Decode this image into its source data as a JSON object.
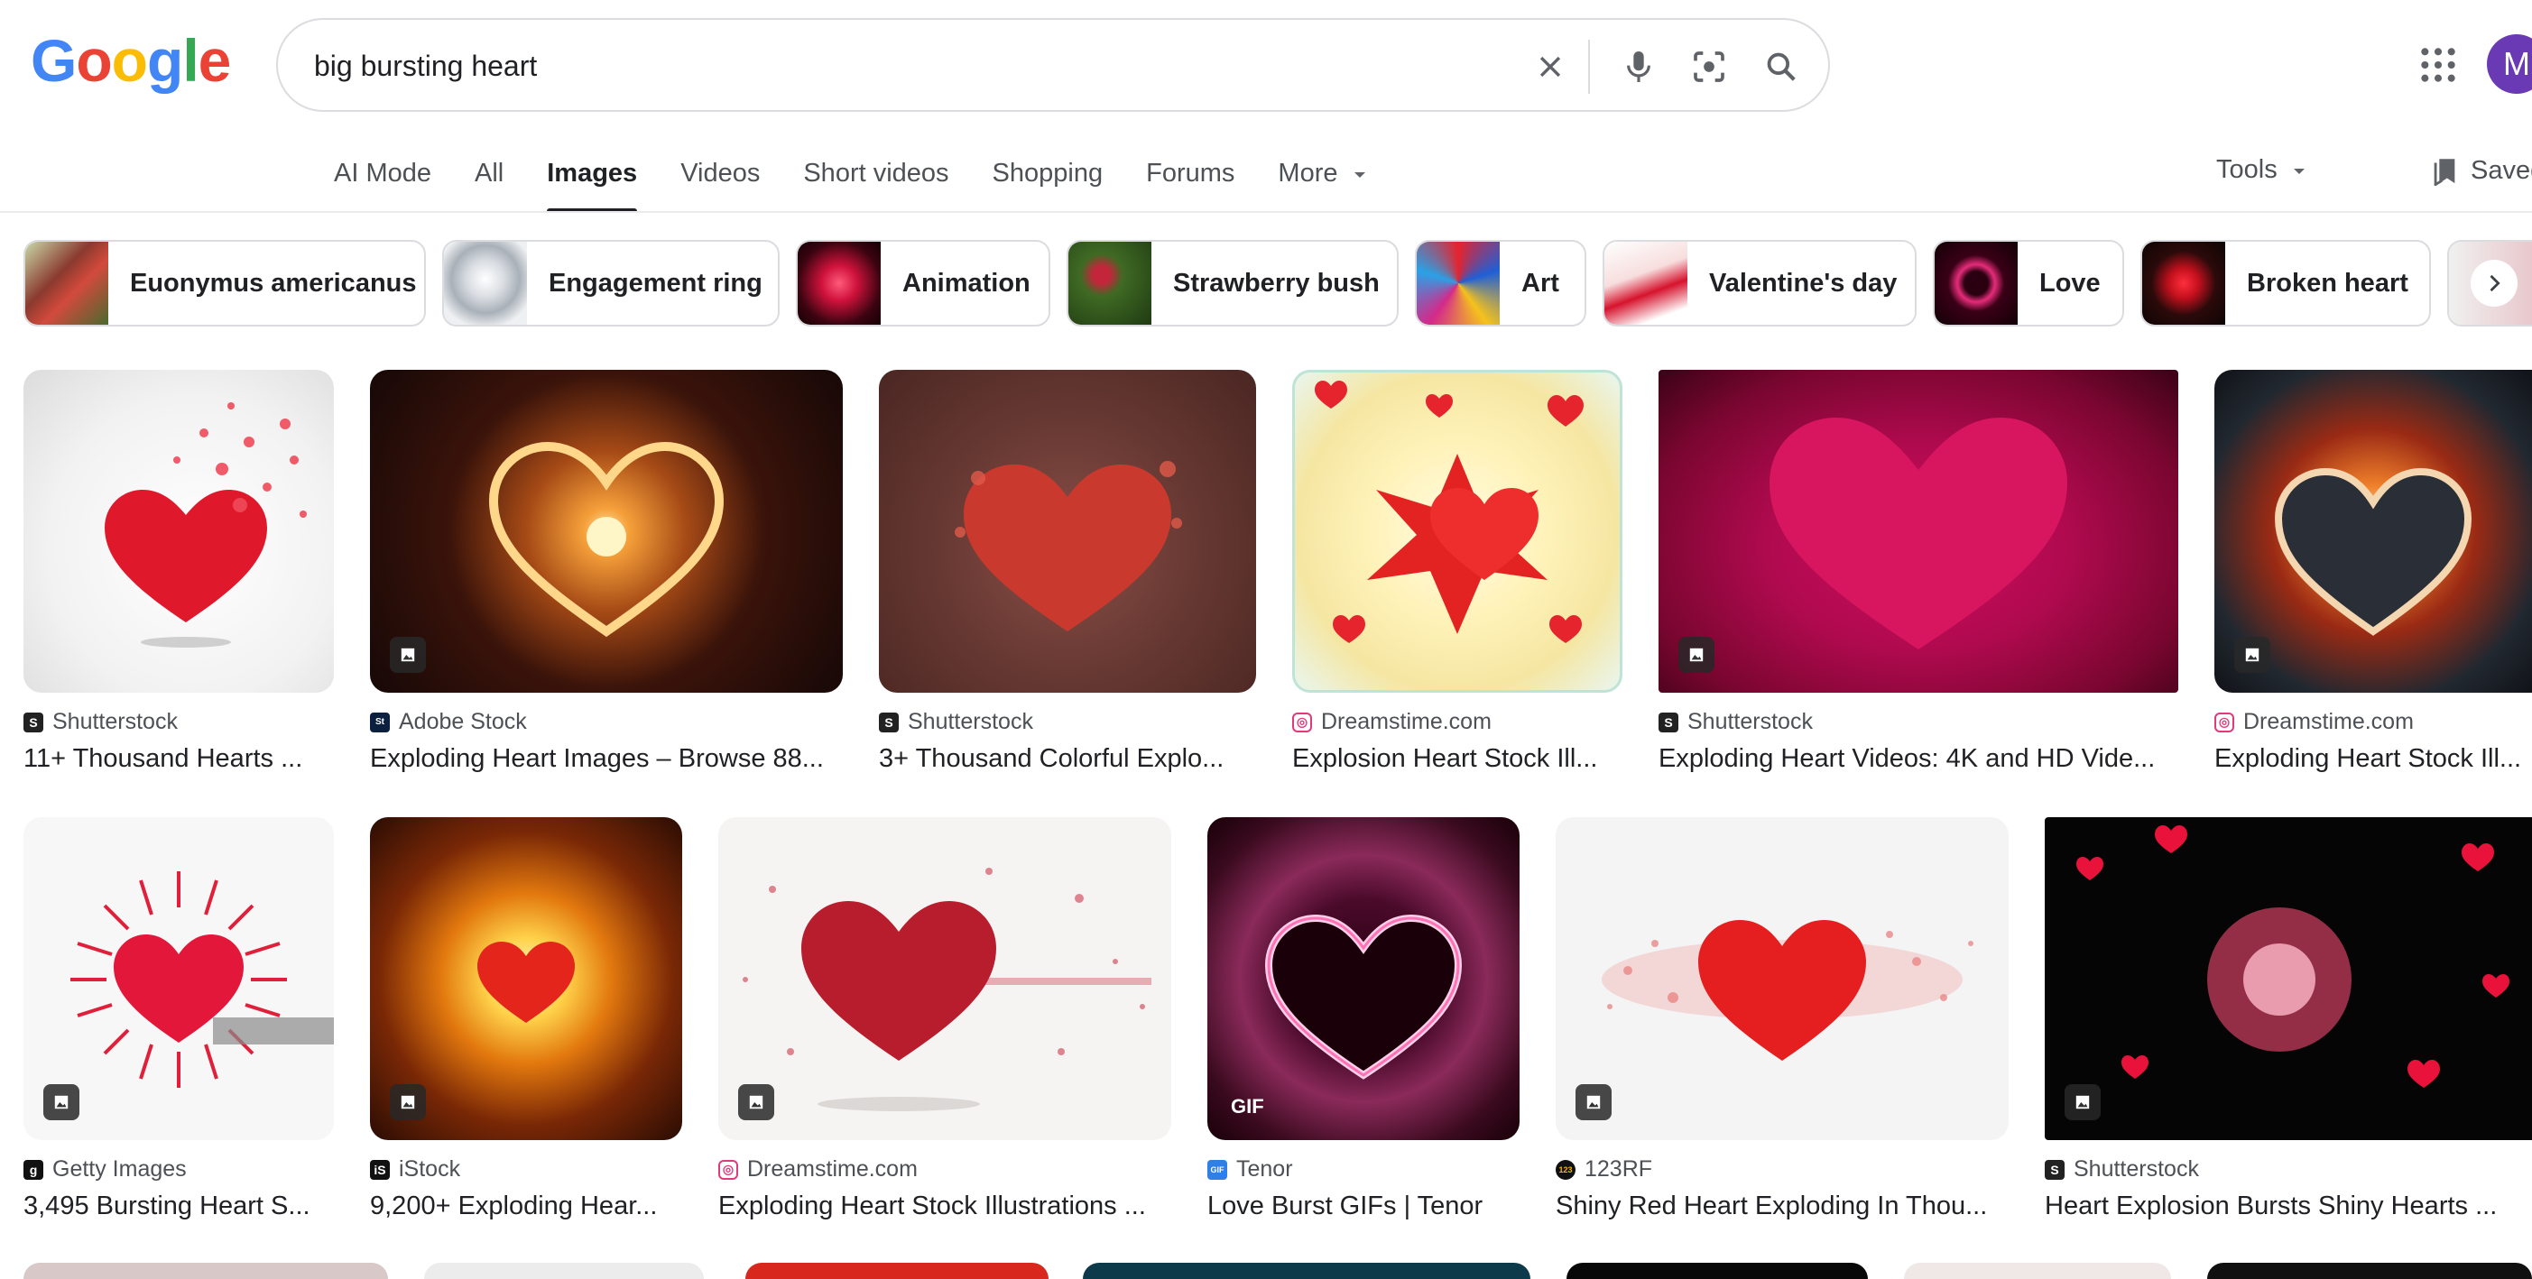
{
  "logo": {
    "letters": [
      "G",
      "o",
      "o",
      "g",
      "l",
      "e"
    ],
    "colors": [
      "#4285F4",
      "#EA4335",
      "#FBBC05",
      "#4285F4",
      "#34A853",
      "#EA4335"
    ]
  },
  "search": {
    "query": "big bursting heart"
  },
  "account": {
    "initial": "M"
  },
  "tabs": [
    {
      "label": "AI Mode",
      "active": false
    },
    {
      "label": "All",
      "active": false
    },
    {
      "label": "Images",
      "active": true
    },
    {
      "label": "Videos",
      "active": false
    },
    {
      "label": "Short videos",
      "active": false
    },
    {
      "label": "Shopping",
      "active": false
    },
    {
      "label": "Forums",
      "active": false
    },
    {
      "label": "More",
      "active": false
    }
  ],
  "tools_label": "Tools",
  "saved_label": "Saved",
  "chips": [
    {
      "label": "Euonymus americanus"
    },
    {
      "label": "Engagement ring"
    },
    {
      "label": "Animation"
    },
    {
      "label": "Strawberry bush"
    },
    {
      "label": "Art"
    },
    {
      "label": "Valentine's day"
    },
    {
      "label": "Love"
    },
    {
      "label": "Broken heart"
    }
  ],
  "results_row1": [
    {
      "source": "Shutterstock",
      "title": "11+ Thousand Hearts ..."
    },
    {
      "source": "Adobe Stock",
      "title": "Exploding Heart Images – Browse 88..."
    },
    {
      "source": "Shutterstock",
      "title": "3+ Thousand Colorful Explo..."
    },
    {
      "source": "Dreamstime.com",
      "title": "Explosion Heart Stock Ill..."
    },
    {
      "source": "Shutterstock",
      "title": "Exploding Heart Videos: 4K and HD Vide..."
    },
    {
      "source": "Dreamstime.com",
      "title": "Exploding Heart Stock Ill..."
    }
  ],
  "results_row2": [
    {
      "source": "Getty Images",
      "title": "3,495 Bursting Heart S..."
    },
    {
      "source": "iStock",
      "title": "9,200+ Exploding Hear..."
    },
    {
      "source": "Dreamstime.com",
      "title": "Exploding Heart Stock Illustrations ..."
    },
    {
      "source": "Tenor",
      "title": "Love Burst GIFs | Tenor",
      "gif": "GIF"
    },
    {
      "source": "123RF",
      "title": "Shiny Red Heart Exploding In Thou..."
    },
    {
      "source": "Shutterstock",
      "title": "Heart Explosion Bursts Shiny Hearts ..."
    }
  ]
}
